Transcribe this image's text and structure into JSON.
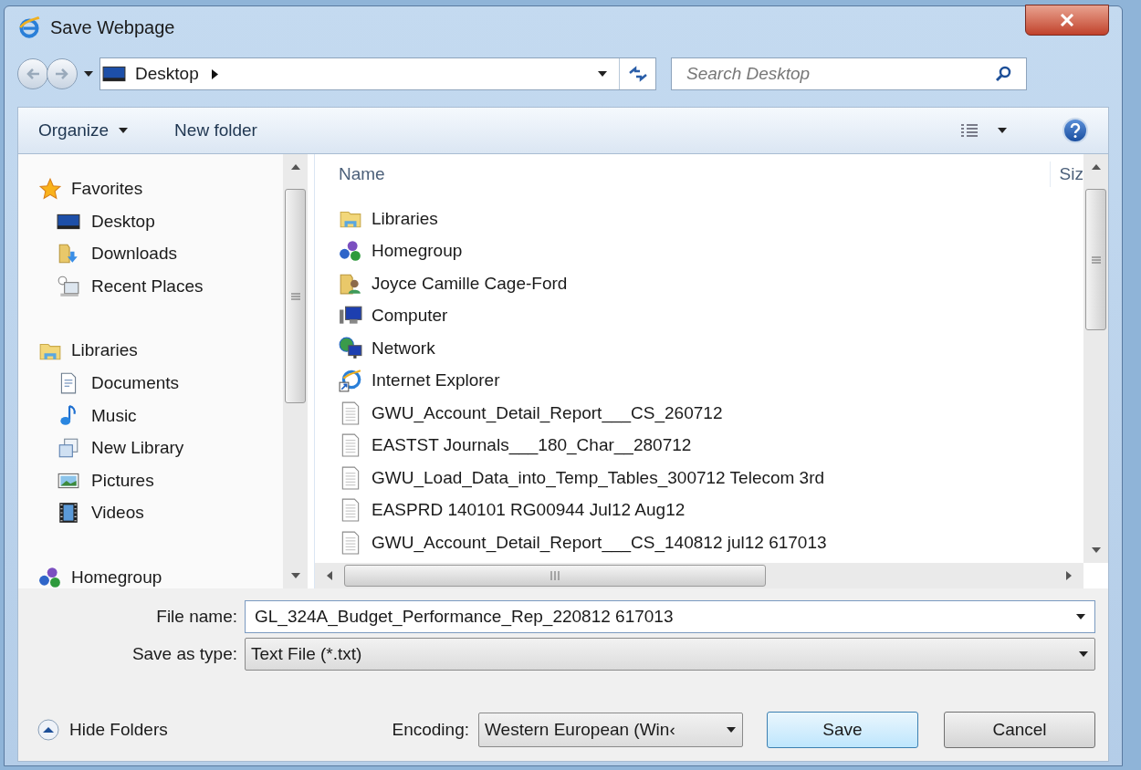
{
  "window": {
    "title": "Save Webpage"
  },
  "address_bar": {
    "location": "Desktop"
  },
  "search": {
    "placeholder": "Search Desktop"
  },
  "toolbar": {
    "organize": "Organize",
    "new_folder": "New folder"
  },
  "nav_pane": [
    {
      "label": "Favorites",
      "kind": "star",
      "children": [
        {
          "label": "Desktop",
          "kind": "desktop"
        },
        {
          "label": "Downloads",
          "kind": "downloads"
        },
        {
          "label": "Recent Places",
          "kind": "recent"
        }
      ]
    },
    {
      "label": "Libraries",
      "kind": "libraries",
      "children": [
        {
          "label": "Documents",
          "kind": "document"
        },
        {
          "label": "Music",
          "kind": "music"
        },
        {
          "label": "New Library",
          "kind": "library"
        },
        {
          "label": "Pictures",
          "kind": "pictures"
        },
        {
          "label": "Videos",
          "kind": "videos"
        }
      ]
    },
    {
      "label": "Homegroup",
      "kind": "homegroup"
    }
  ],
  "file_list": {
    "columns": [
      "Name",
      "Siz"
    ],
    "items": [
      {
        "name": "Libraries",
        "kind": "libraries"
      },
      {
        "name": "Homegroup",
        "kind": "homegroup"
      },
      {
        "name": "Joyce Camille Cage-Ford",
        "kind": "user"
      },
      {
        "name": "Computer",
        "kind": "computer"
      },
      {
        "name": "Network",
        "kind": "network"
      },
      {
        "name": "Internet Explorer",
        "kind": "browser"
      },
      {
        "name": "GWU_Account_Detail_Report___CS_260712",
        "kind": "text"
      },
      {
        "name": "EASTST Journals___180_Char__280712",
        "kind": "text"
      },
      {
        "name": "GWU_Load_Data_into_Temp_Tables_300712 Telecom 3rd",
        "kind": "text"
      },
      {
        "name": "EASPRD 140101 RG00944 Jul12 Aug12",
        "kind": "text"
      },
      {
        "name": "GWU_Account_Detail_Report___CS_140812 jul12 617013",
        "kind": "text"
      }
    ]
  },
  "file_name": {
    "label": "File name:",
    "value": "GL_324A_Budget_Performance_Rep_220812 617013"
  },
  "save_as_type": {
    "label": "Save as type:",
    "value": "Text File (*.txt)"
  },
  "encoding": {
    "label": "Encoding:",
    "value": "Western European (Win‹"
  },
  "buttons": {
    "hide_folders": "Hide Folders",
    "save": "Save",
    "cancel": "Cancel"
  }
}
